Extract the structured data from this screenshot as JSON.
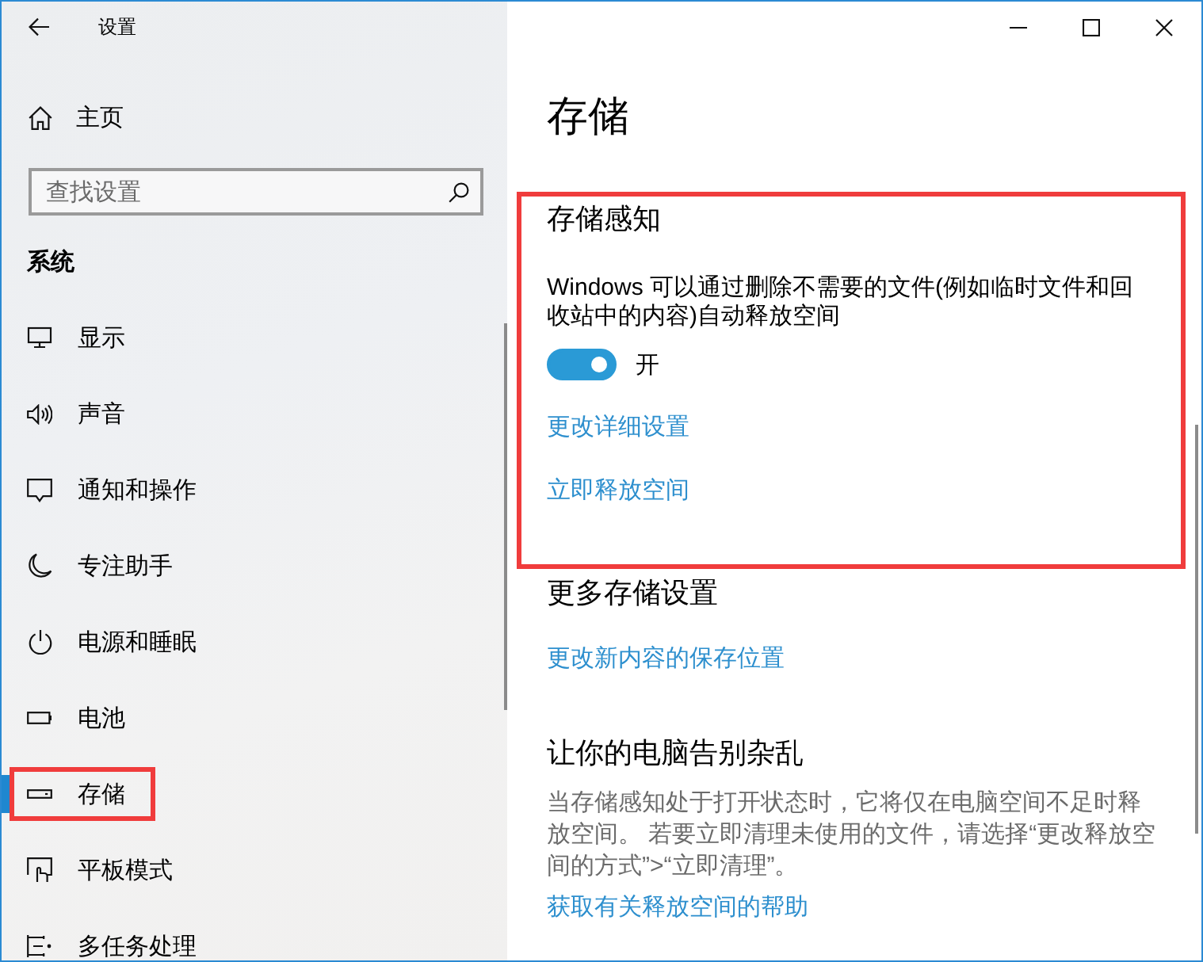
{
  "window": {
    "title": "设置"
  },
  "sidebar": {
    "home": "主页",
    "search": {
      "placeholder": "查找设置"
    },
    "section": "系统",
    "items": [
      {
        "label": "显示",
        "kind": "display",
        "selected": false,
        "highlighted": false
      },
      {
        "label": "声音",
        "kind": "sound",
        "selected": false,
        "highlighted": false
      },
      {
        "label": "通知和操作",
        "kind": "notifications",
        "selected": false,
        "highlighted": false
      },
      {
        "label": "专注助手",
        "kind": "focus",
        "selected": false,
        "highlighted": false
      },
      {
        "label": "电源和睡眠",
        "kind": "power",
        "selected": false,
        "highlighted": false
      },
      {
        "label": "电池",
        "kind": "battery",
        "selected": false,
        "highlighted": false
      },
      {
        "label": "存储",
        "kind": "storage",
        "selected": true,
        "highlighted": true
      },
      {
        "label": "平板模式",
        "kind": "tablet",
        "selected": false,
        "highlighted": false
      },
      {
        "label": "多任务处理",
        "kind": "multitasking",
        "selected": false,
        "highlighted": false
      }
    ]
  },
  "page": {
    "title": "存储",
    "storage_sense": {
      "highlighted": true,
      "title": "存储感知",
      "description": "Windows 可以通过删除不需要的文件(例如临时文件和回收站中的内容)自动释放空间",
      "toggle": {
        "on": true,
        "label": "开"
      },
      "links": [
        "更改详细设置",
        "立即释放空间"
      ]
    },
    "more_settings": {
      "title": "更多存储设置",
      "links": [
        "更改新内容的保存位置"
      ]
    },
    "declutter": {
      "title": "让你的电脑告别杂乱",
      "description": "当存储感知处于打开状态时，它将仅在电脑空间不足时释放空间。 若要立即清理未使用的文件，请选择“更改释放空间的方式”>“立即清理”。",
      "links": [
        "获取有关释放空间的帮助"
      ]
    }
  }
}
